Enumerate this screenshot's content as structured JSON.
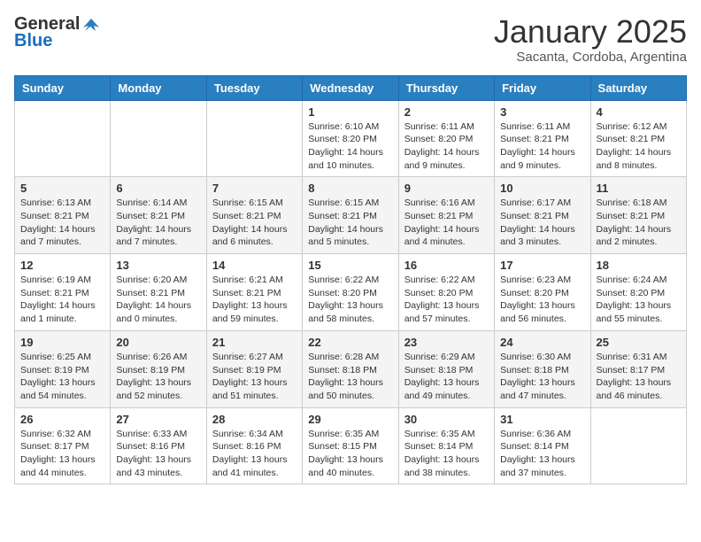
{
  "header": {
    "logo_general": "General",
    "logo_blue": "Blue",
    "month": "January 2025",
    "location": "Sacanta, Cordoba, Argentina"
  },
  "days_of_week": [
    "Sunday",
    "Monday",
    "Tuesday",
    "Wednesday",
    "Thursday",
    "Friday",
    "Saturday"
  ],
  "weeks": [
    [
      {
        "day": "",
        "info": ""
      },
      {
        "day": "",
        "info": ""
      },
      {
        "day": "",
        "info": ""
      },
      {
        "day": "1",
        "info": "Sunrise: 6:10 AM\nSunset: 8:20 PM\nDaylight: 14 hours and 10 minutes."
      },
      {
        "day": "2",
        "info": "Sunrise: 6:11 AM\nSunset: 8:20 PM\nDaylight: 14 hours and 9 minutes."
      },
      {
        "day": "3",
        "info": "Sunrise: 6:11 AM\nSunset: 8:21 PM\nDaylight: 14 hours and 9 minutes."
      },
      {
        "day": "4",
        "info": "Sunrise: 6:12 AM\nSunset: 8:21 PM\nDaylight: 14 hours and 8 minutes."
      }
    ],
    [
      {
        "day": "5",
        "info": "Sunrise: 6:13 AM\nSunset: 8:21 PM\nDaylight: 14 hours and 7 minutes."
      },
      {
        "day": "6",
        "info": "Sunrise: 6:14 AM\nSunset: 8:21 PM\nDaylight: 14 hours and 7 minutes."
      },
      {
        "day": "7",
        "info": "Sunrise: 6:15 AM\nSunset: 8:21 PM\nDaylight: 14 hours and 6 minutes."
      },
      {
        "day": "8",
        "info": "Sunrise: 6:15 AM\nSunset: 8:21 PM\nDaylight: 14 hours and 5 minutes."
      },
      {
        "day": "9",
        "info": "Sunrise: 6:16 AM\nSunset: 8:21 PM\nDaylight: 14 hours and 4 minutes."
      },
      {
        "day": "10",
        "info": "Sunrise: 6:17 AM\nSunset: 8:21 PM\nDaylight: 14 hours and 3 minutes."
      },
      {
        "day": "11",
        "info": "Sunrise: 6:18 AM\nSunset: 8:21 PM\nDaylight: 14 hours and 2 minutes."
      }
    ],
    [
      {
        "day": "12",
        "info": "Sunrise: 6:19 AM\nSunset: 8:21 PM\nDaylight: 14 hours and 1 minute."
      },
      {
        "day": "13",
        "info": "Sunrise: 6:20 AM\nSunset: 8:21 PM\nDaylight: 14 hours and 0 minutes."
      },
      {
        "day": "14",
        "info": "Sunrise: 6:21 AM\nSunset: 8:21 PM\nDaylight: 13 hours and 59 minutes."
      },
      {
        "day": "15",
        "info": "Sunrise: 6:22 AM\nSunset: 8:20 PM\nDaylight: 13 hours and 58 minutes."
      },
      {
        "day": "16",
        "info": "Sunrise: 6:22 AM\nSunset: 8:20 PM\nDaylight: 13 hours and 57 minutes."
      },
      {
        "day": "17",
        "info": "Sunrise: 6:23 AM\nSunset: 8:20 PM\nDaylight: 13 hours and 56 minutes."
      },
      {
        "day": "18",
        "info": "Sunrise: 6:24 AM\nSunset: 8:20 PM\nDaylight: 13 hours and 55 minutes."
      }
    ],
    [
      {
        "day": "19",
        "info": "Sunrise: 6:25 AM\nSunset: 8:19 PM\nDaylight: 13 hours and 54 minutes."
      },
      {
        "day": "20",
        "info": "Sunrise: 6:26 AM\nSunset: 8:19 PM\nDaylight: 13 hours and 52 minutes."
      },
      {
        "day": "21",
        "info": "Sunrise: 6:27 AM\nSunset: 8:19 PM\nDaylight: 13 hours and 51 minutes."
      },
      {
        "day": "22",
        "info": "Sunrise: 6:28 AM\nSunset: 8:18 PM\nDaylight: 13 hours and 50 minutes."
      },
      {
        "day": "23",
        "info": "Sunrise: 6:29 AM\nSunset: 8:18 PM\nDaylight: 13 hours and 49 minutes."
      },
      {
        "day": "24",
        "info": "Sunrise: 6:30 AM\nSunset: 8:18 PM\nDaylight: 13 hours and 47 minutes."
      },
      {
        "day": "25",
        "info": "Sunrise: 6:31 AM\nSunset: 8:17 PM\nDaylight: 13 hours and 46 minutes."
      }
    ],
    [
      {
        "day": "26",
        "info": "Sunrise: 6:32 AM\nSunset: 8:17 PM\nDaylight: 13 hours and 44 minutes."
      },
      {
        "day": "27",
        "info": "Sunrise: 6:33 AM\nSunset: 8:16 PM\nDaylight: 13 hours and 43 minutes."
      },
      {
        "day": "28",
        "info": "Sunrise: 6:34 AM\nSunset: 8:16 PM\nDaylight: 13 hours and 41 minutes."
      },
      {
        "day": "29",
        "info": "Sunrise: 6:35 AM\nSunset: 8:15 PM\nDaylight: 13 hours and 40 minutes."
      },
      {
        "day": "30",
        "info": "Sunrise: 6:35 AM\nSunset: 8:14 PM\nDaylight: 13 hours and 38 minutes."
      },
      {
        "day": "31",
        "info": "Sunrise: 6:36 AM\nSunset: 8:14 PM\nDaylight: 13 hours and 37 minutes."
      },
      {
        "day": "",
        "info": ""
      }
    ]
  ]
}
